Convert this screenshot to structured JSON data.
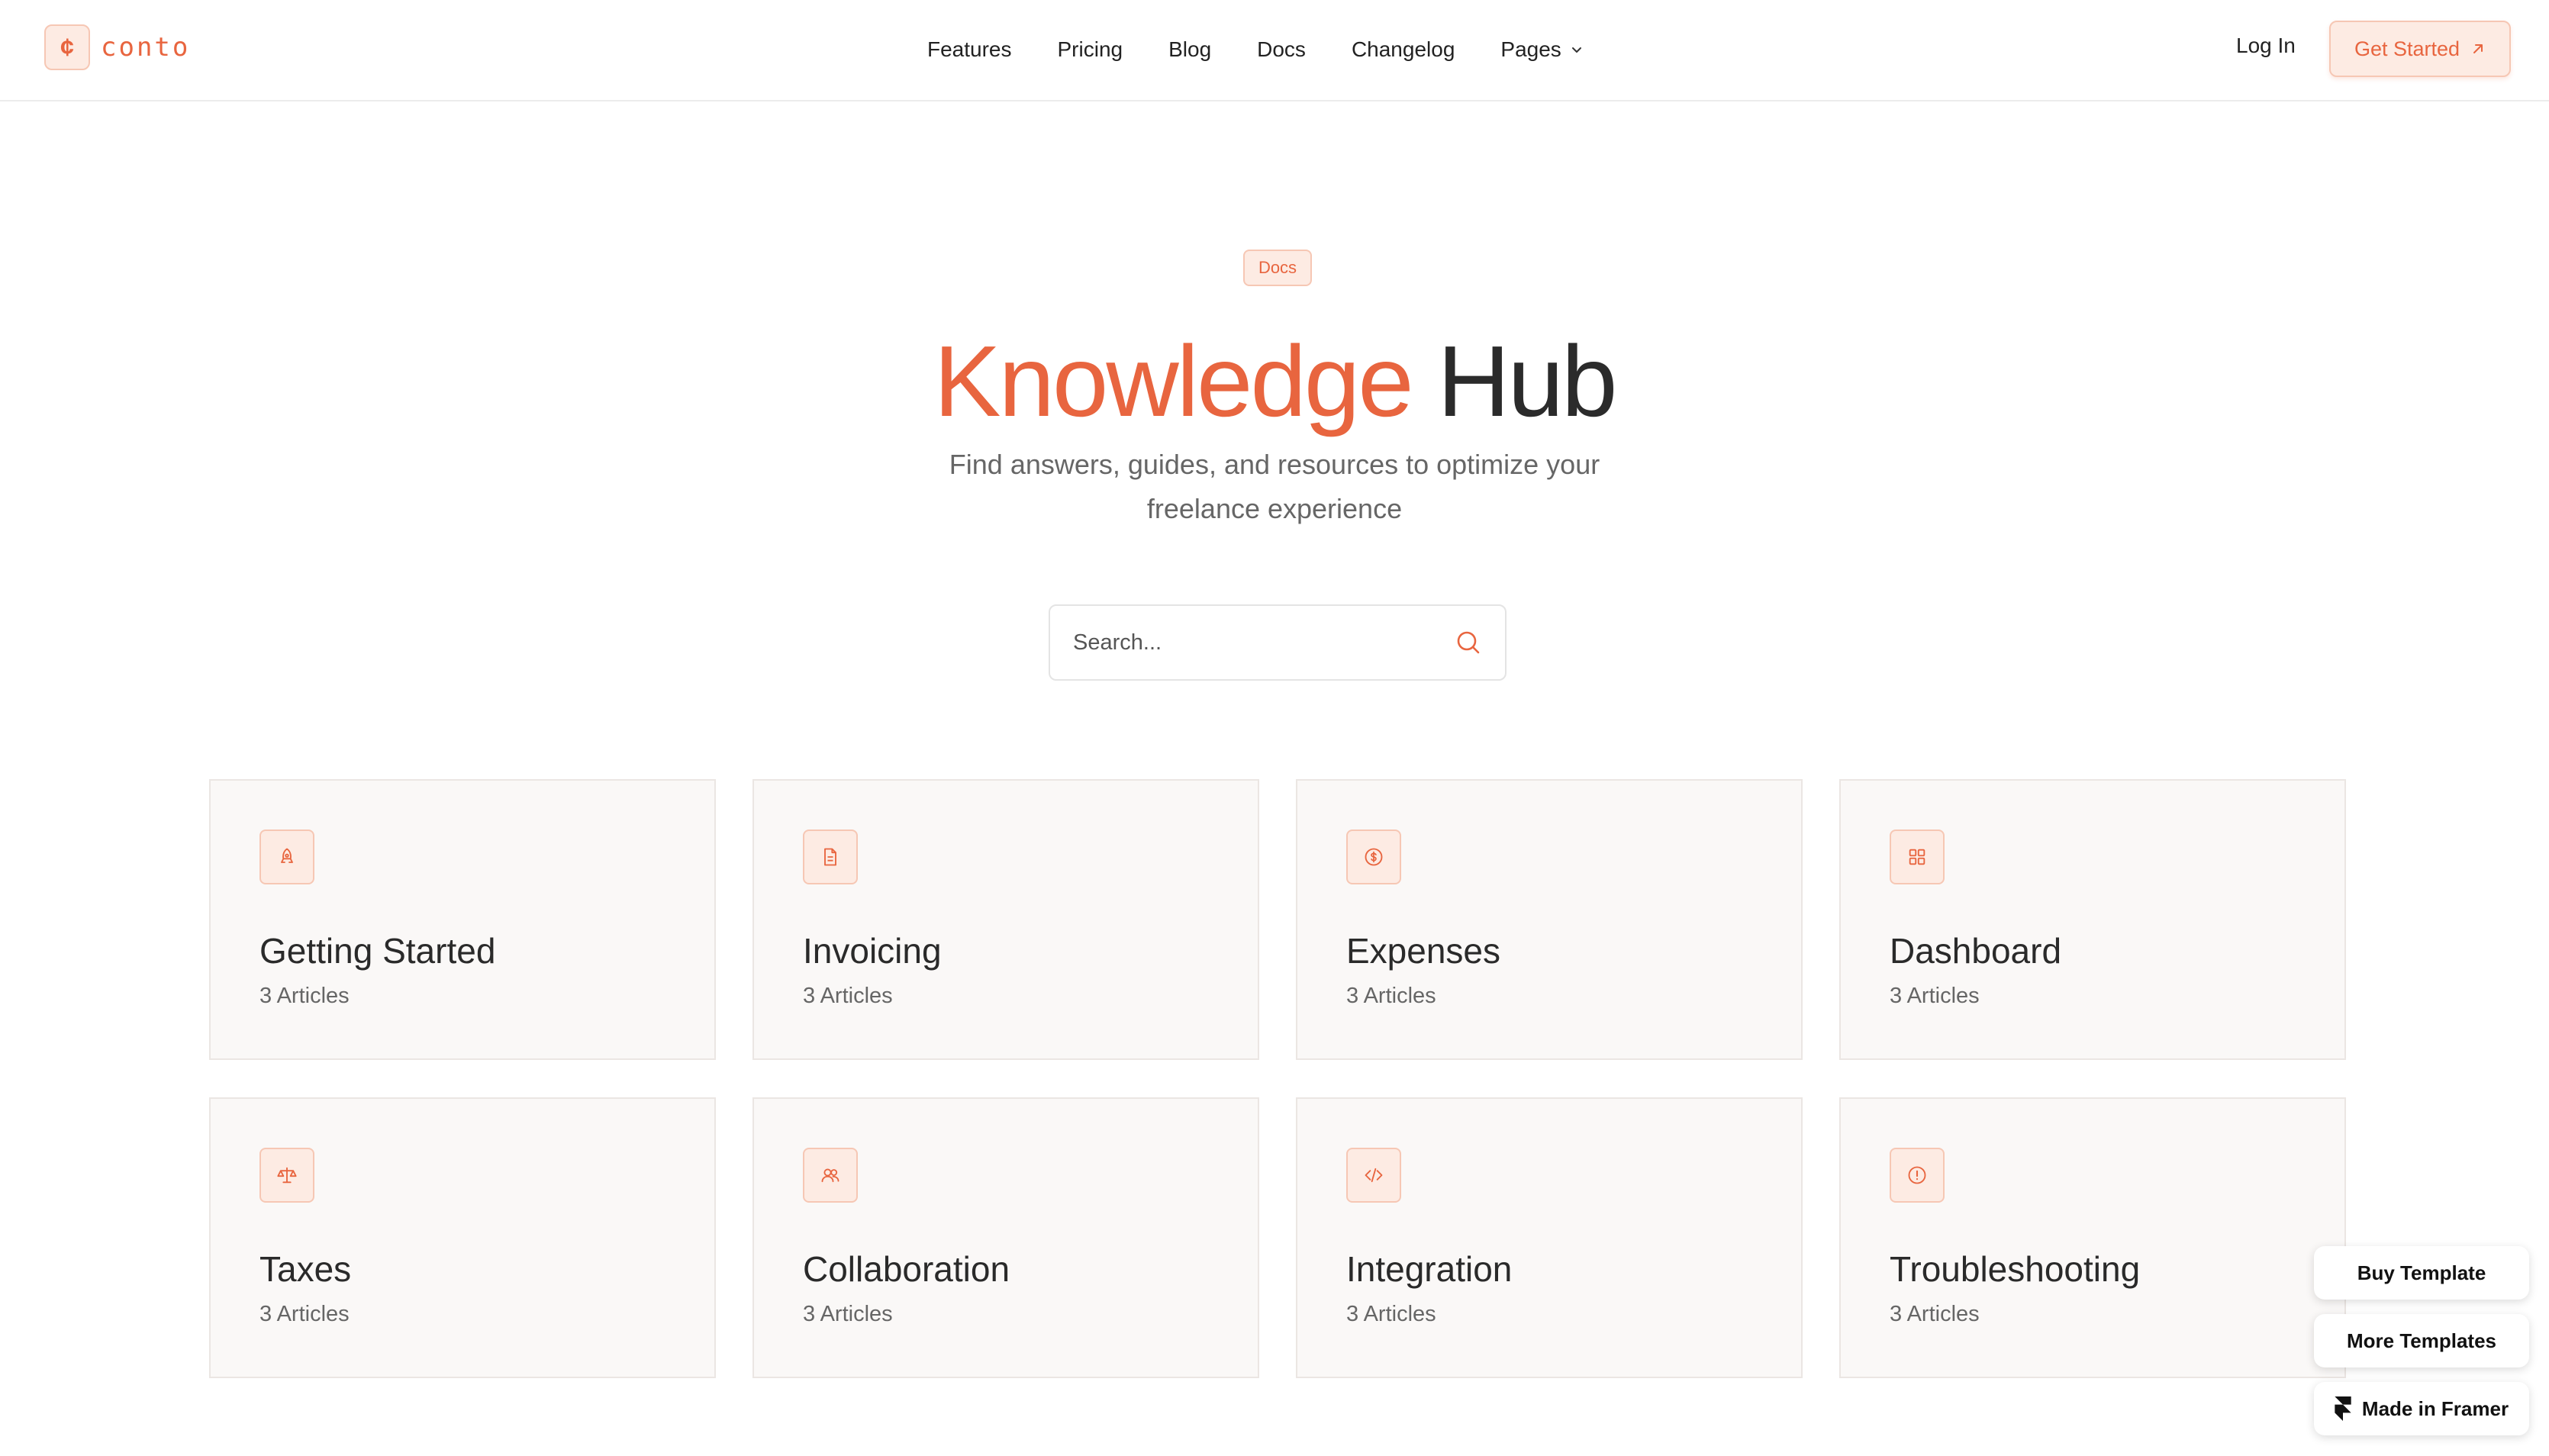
{
  "nav": {
    "logo_mark": "¢",
    "logo_text": "conto",
    "links": [
      {
        "label": "Features"
      },
      {
        "label": "Pricing"
      },
      {
        "label": "Blog"
      },
      {
        "label": "Docs"
      },
      {
        "label": "Changelog"
      },
      {
        "label": "Pages"
      }
    ],
    "login_label": "Log In",
    "cta_label": "Get Started",
    "cta_icon": "arrow-up-right-icon"
  },
  "hero": {
    "badge": "Docs",
    "title_accent": "Knowledge",
    "title_rest": "Hub",
    "subtitle": "Find answers, guides, and resources to optimize your freelance experience"
  },
  "search": {
    "placeholder": "Search...",
    "icon": "search-icon"
  },
  "categories": [
    {
      "title": "Getting Started",
      "count": "3 Articles",
      "icon": "rocket-icon"
    },
    {
      "title": "Invoicing",
      "count": "3 Articles",
      "icon": "file-text-icon"
    },
    {
      "title": "Expenses",
      "count": "3 Articles",
      "icon": "dollar-coin-icon"
    },
    {
      "title": "Dashboard",
      "count": "3 Articles",
      "icon": "grid-icon"
    },
    {
      "title": "Taxes",
      "count": "3 Articles",
      "icon": "scale-icon"
    },
    {
      "title": "Collaboration",
      "count": "3 Articles",
      "icon": "users-icon"
    },
    {
      "title": "Integration",
      "count": "3 Articles",
      "icon": "code-icon"
    },
    {
      "title": "Troubleshooting",
      "count": "3 Articles",
      "icon": "alert-circle-icon"
    }
  ],
  "floating": {
    "buy_template": "Buy Template",
    "more_templates": "More Templates",
    "made_in_framer": "Made in Framer"
  },
  "colors": {
    "accent": "#e8653f",
    "accent_bg": "#fdebe3",
    "card_bg": "#faf8f7",
    "text_dark": "#2a2a2a"
  }
}
